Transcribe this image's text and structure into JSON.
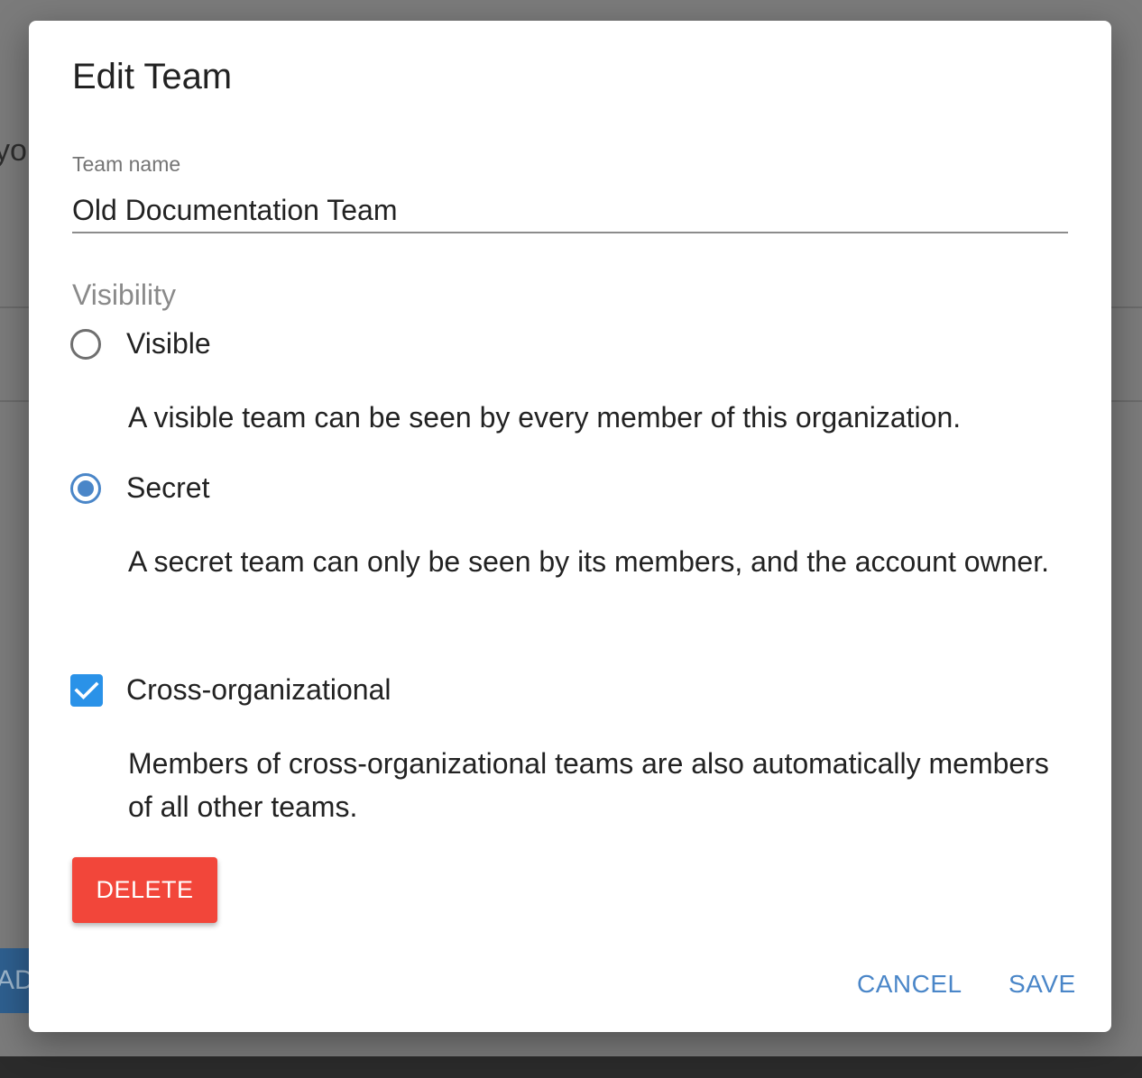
{
  "background": {
    "fragment_top": "you",
    "fragment_button": "ADD"
  },
  "dialog": {
    "title": "Edit Team",
    "team_name": {
      "label": "Team name",
      "value": "Old Documentation Team"
    },
    "visibility": {
      "label": "Visibility",
      "options": [
        {
          "label": "Visible",
          "description": "A visible team can be seen by every member of this organization.",
          "selected": false
        },
        {
          "label": "Secret",
          "description": "A secret team can only be seen by its members, and the account owner.",
          "selected": true
        }
      ]
    },
    "cross_org": {
      "label": "Cross-organizational",
      "description": "Members of cross-organizational teams are also automatically members of all other teams.",
      "checked": true
    },
    "buttons": {
      "delete": "DELETE",
      "cancel": "CANCEL",
      "save": "SAVE"
    }
  },
  "colors": {
    "accent": "#4a86c8",
    "checkbox": "#2a92e8",
    "danger": "#f2463a",
    "overlay": "#7b7b7b"
  }
}
